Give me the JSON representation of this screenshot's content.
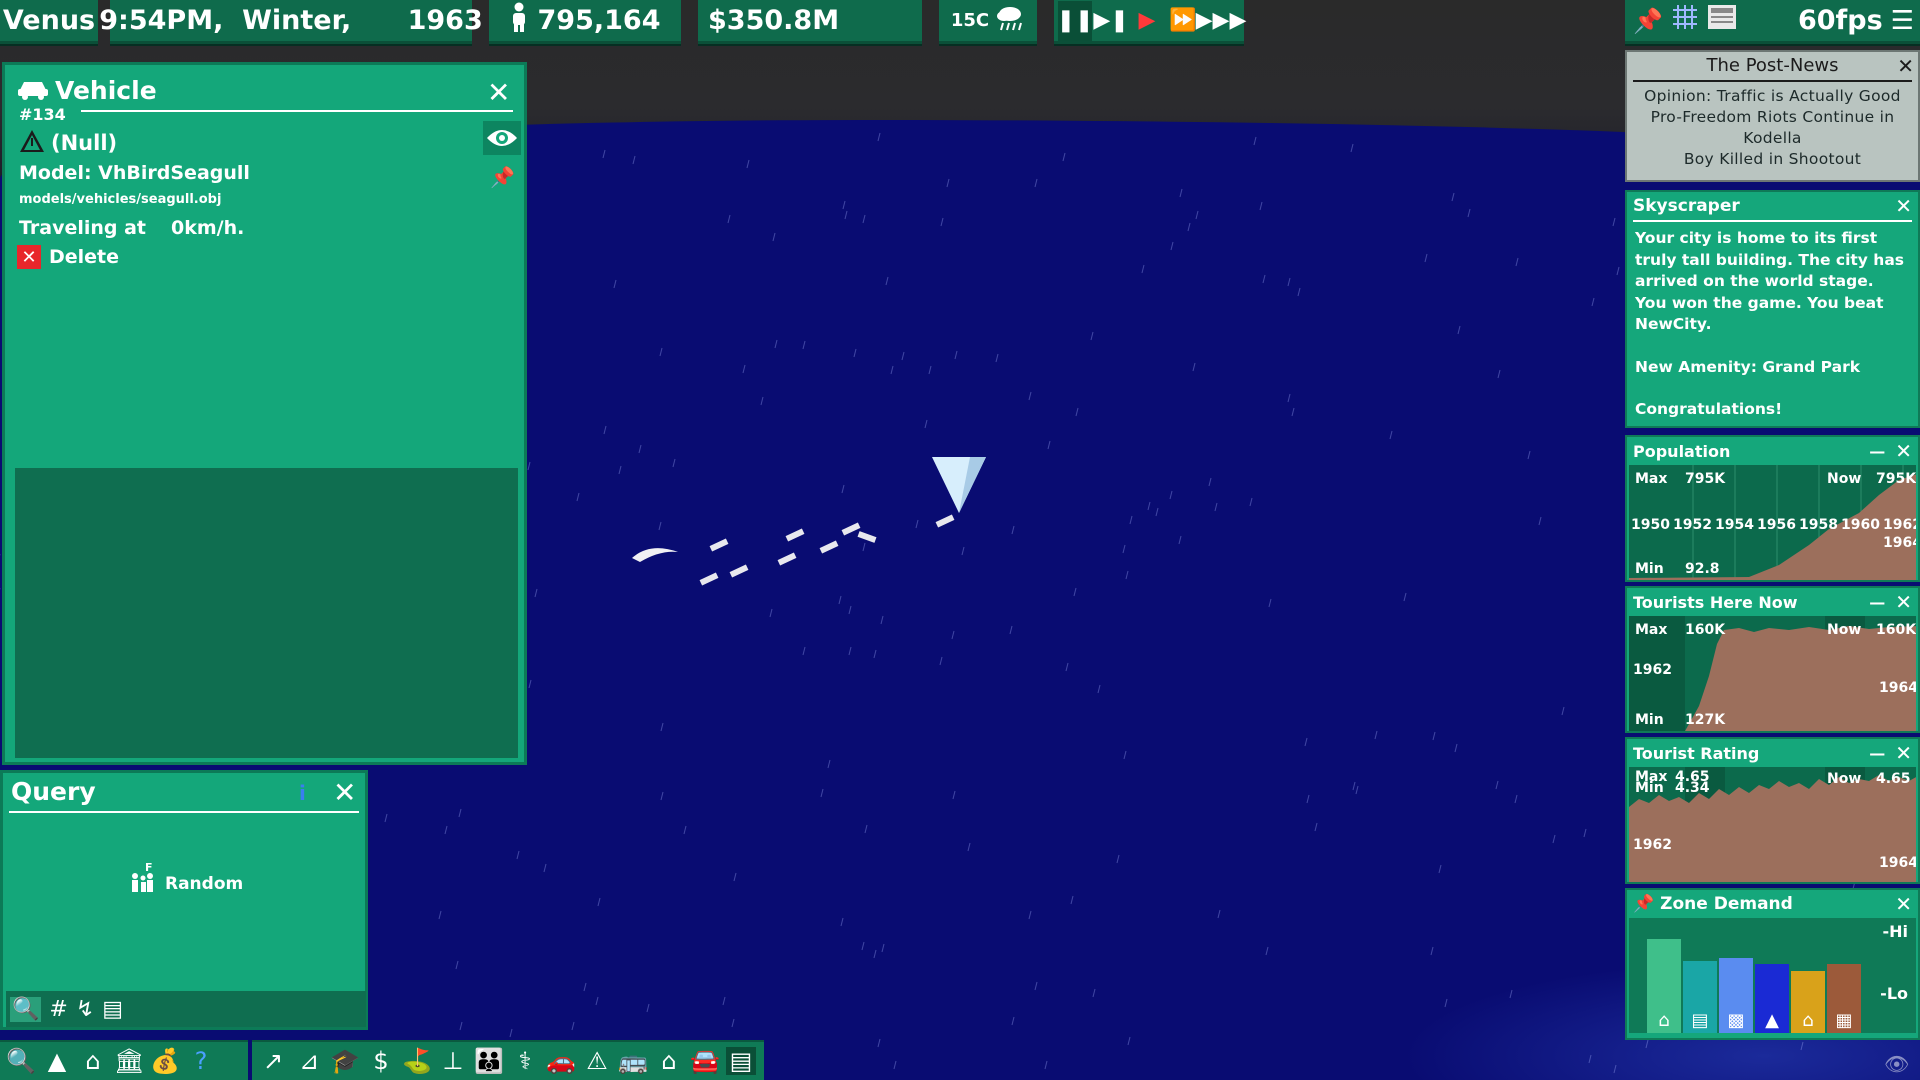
{
  "top_bar": {
    "city_name": "Venus",
    "datetime": "9:54PM,  Winter,      1963",
    "population": "795,164",
    "money": "$350.8M",
    "temperature": "15C",
    "fps": "60fps"
  },
  "vehicle_panel": {
    "title": "Vehicle",
    "id": "#134",
    "driver": "(Null)",
    "model": "Model:  VhBirdSeagull",
    "model_path": "models/vehicles/seagull.obj",
    "speed_label": "Traveling at",
    "speed_value": "0km/h.",
    "delete_label": "Delete"
  },
  "query_panel": {
    "title": "Query",
    "random_label": "Random",
    "random_hotkey": "F"
  },
  "news": {
    "title": "The  Post-News",
    "headlines": [
      "Opinion: Traffic is Actually Good",
      "Pro-Freedom Riots Continue in",
      "Kodella",
      "Boy Killed in Shootout"
    ]
  },
  "skyscraper": {
    "title": "Skyscraper",
    "body": "Your city is home to its first truly tall building. The city has arrived on the world stage. You won the game. You beat NewCity.",
    "amenity": "New Amenity: Grand Park",
    "congrats": "Congratulations!"
  },
  "population_graph": {
    "title": "Population",
    "max_label": "Max",
    "max_value": "795K",
    "now_label": "Now",
    "now_value": "795K",
    "min_label": "Min",
    "min_value": "92.8",
    "years": [
      "1950",
      "1952",
      "1954",
      "1956",
      "1958",
      "1960",
      "1962"
    ],
    "end_year": "1964"
  },
  "tourists_graph": {
    "title": "Tourists  Here  Now",
    "max_label": "Max",
    "max_value": "160K",
    "now_label": "Now",
    "now_value": "160K",
    "min_label": "Min",
    "min_value": "127K",
    "start_year": "1962",
    "end_year": "1964"
  },
  "rating_graph": {
    "title": "Tourist  Rating",
    "max_label": "Max",
    "max_value": "4.65",
    "min_label": "Min",
    "min_value": "4.34",
    "now_label": "Now",
    "now_value": "4.65",
    "start_year": "1962",
    "end_year": "1964"
  },
  "zone_demand": {
    "title": "Zone  Demand",
    "hi_label": "-Hi",
    "lo_label": "-Lo",
    "bars": [
      {
        "zone": "residential",
        "level": 0.78,
        "color": "#3fbf8a"
      },
      {
        "zone": "retail",
        "level": 0.55,
        "color": "#1aa6a6"
      },
      {
        "zone": "office",
        "level": 0.58,
        "color": "#5a8cf0"
      },
      {
        "zone": "industrial",
        "level": 0.52,
        "color": "#1a2ad4"
      },
      {
        "zone": "farm",
        "level": 0.44,
        "color": "#d9a21a"
      },
      {
        "zone": "government",
        "level": 0.52,
        "color": "#9c5a3a"
      }
    ]
  },
  "colors": {
    "panel": "#14a77a",
    "panel_dark": "#0f6e50",
    "sea": "#090c72",
    "news_bg": "#b9c4c0"
  }
}
